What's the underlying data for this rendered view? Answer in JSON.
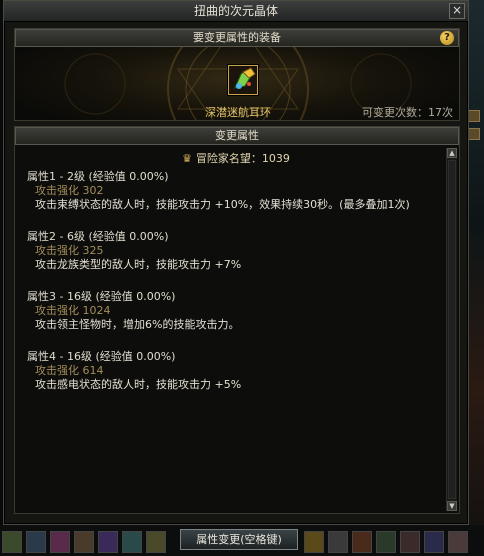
{
  "window": {
    "title": "扭曲的次元晶体",
    "close_glyph": "×"
  },
  "equipment": {
    "header": "要变更属性的装备",
    "help_glyph": "?",
    "item_name": "深潜迷航耳环",
    "remaining_changes": "可变更次数：17次"
  },
  "attributes": {
    "header": "变更属性",
    "renown": "冒险家名望：1039",
    "items": [
      {
        "title": "属性1 - 2级 (经验值 0.00%)",
        "stat": "攻击强化 302",
        "desc": "攻击束缚状态的敌人时，技能攻击力 +10%，效果持续30秒。(最多叠加1次)"
      },
      {
        "title": "属性2 - 6级 (经验值 0.00%)",
        "stat": "攻击强化 325",
        "desc": "攻击龙族类型的敌人时，技能攻击力 +7%"
      },
      {
        "title": "属性3 - 16级 (经验值 0.00%)",
        "stat": "攻击强化 1024",
        "desc": "攻击领主怪物时，增加6%的技能攻击力。"
      },
      {
        "title": "属性4 - 16级 (经验值 0.00%)",
        "stat": "攻击强化 614",
        "desc": "攻击感电状态的敌人时，技能攻击力 +5%"
      }
    ]
  },
  "action_button": "属性变更(空格键)",
  "colors": {
    "accent_gold": "#e8c86a",
    "stat_color": "#a48d5a"
  }
}
